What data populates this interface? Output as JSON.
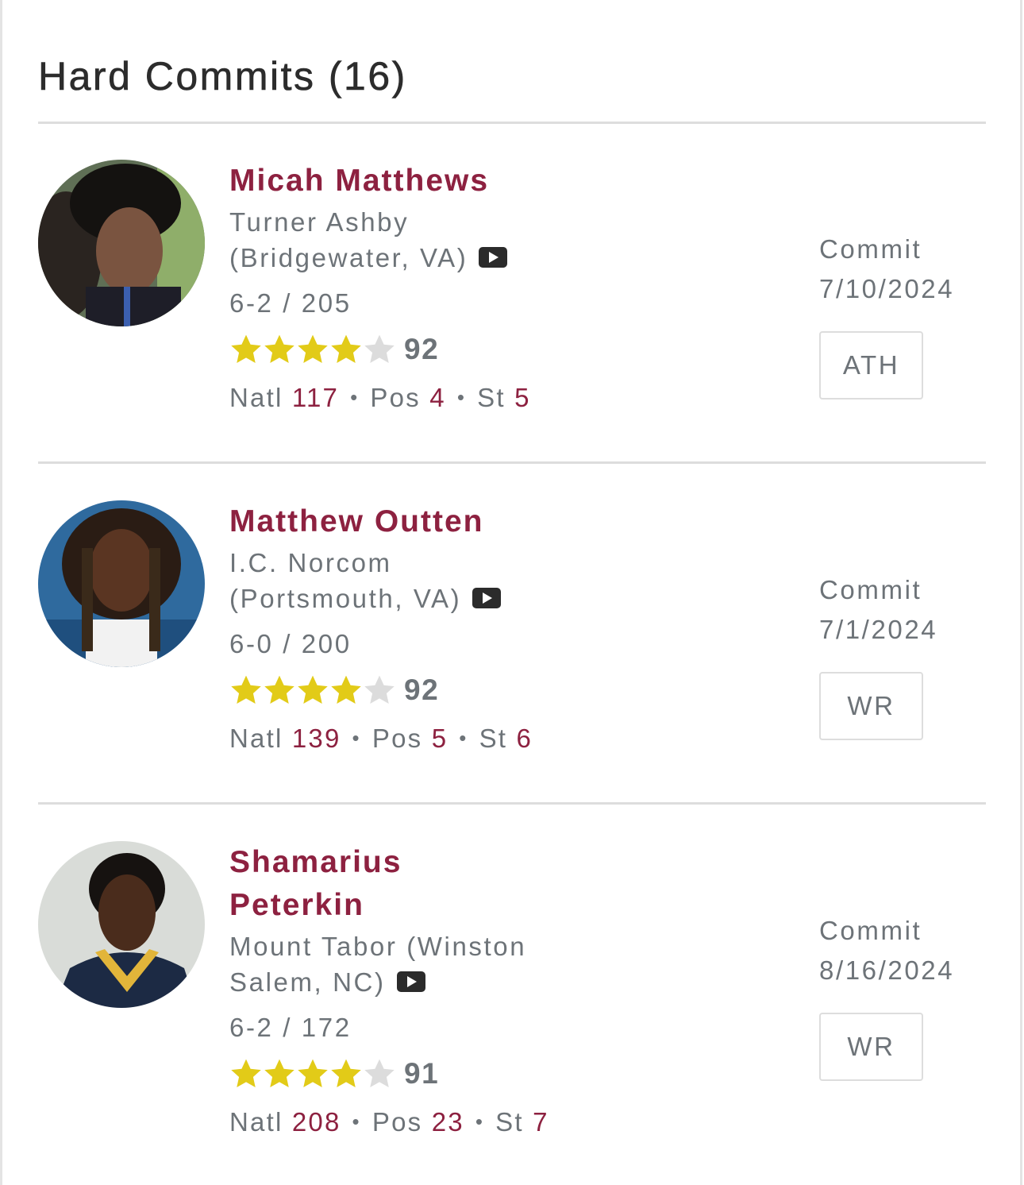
{
  "section": {
    "title": "Hard Commits (16)"
  },
  "players": [
    {
      "name": "Micah Matthews",
      "school": "Turner Ashby (Bridgewater, VA)",
      "school_line1": "Turner Ashby",
      "school_line2": "(Bridgewater, VA)",
      "measurements": "6-2 / 205",
      "stars": 4,
      "rating": "92",
      "natl_label": "Natl",
      "natl": "117",
      "pos_label": "Pos",
      "pos_rank": "4",
      "st_label": "St",
      "st_rank": "5",
      "commit_label": "Commit",
      "commit_date": "7/10/2024",
      "position": "ATH",
      "video_icon": "video-play-icon"
    },
    {
      "name": "Matthew Outten",
      "school": "I.C. Norcom (Portsmouth, VA)",
      "school_line1": "I.C. Norcom",
      "school_line2": "(Portsmouth, VA)",
      "measurements": "6-0 / 200",
      "stars": 4,
      "rating": "92",
      "natl_label": "Natl",
      "natl": "139",
      "pos_label": "Pos",
      "pos_rank": "5",
      "st_label": "St",
      "st_rank": "6",
      "commit_label": "Commit",
      "commit_date": "7/1/2024",
      "position": "WR",
      "video_icon": "video-play-icon"
    },
    {
      "name": "Shamarius Peterkin",
      "school": "Mount Tabor (Winston Salem, NC)",
      "school_line1": "Mount Tabor (Winston",
      "school_line2": "Salem, NC)",
      "measurements": "6-2 / 172",
      "stars": 4,
      "rating": "91",
      "natl_label": "Natl",
      "natl": "208",
      "pos_label": "Pos",
      "pos_rank": "23",
      "st_label": "St",
      "st_rank": "7",
      "commit_label": "Commit",
      "commit_date": "8/16/2024",
      "position": "WR",
      "video_icon": "video-play-icon"
    }
  ],
  "colors": {
    "accent": "#8d2140",
    "text_muted": "#6d7378",
    "star_filled": "#e2cb18",
    "star_empty": "#dcdcdc",
    "divider": "#dddddd"
  }
}
